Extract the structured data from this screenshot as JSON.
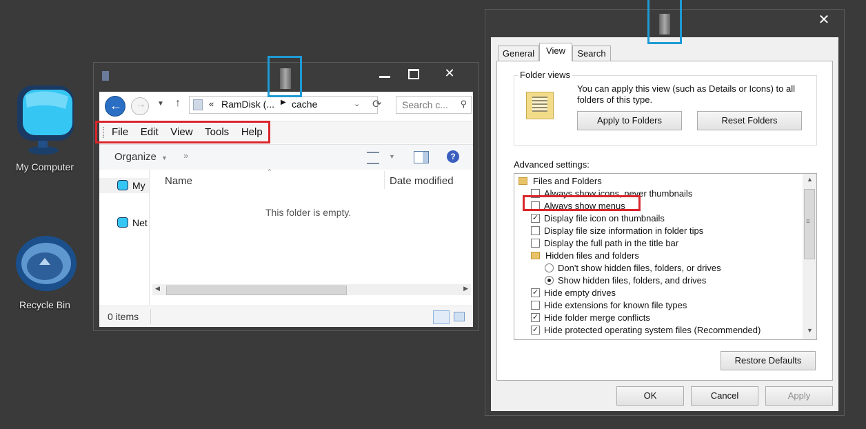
{
  "desktop": {
    "icons": [
      {
        "label": "My Computer"
      },
      {
        "label": "Recycle Bin"
      }
    ]
  },
  "explorer": {
    "address": {
      "segment1": "RamDisk (...",
      "segment2": "cache",
      "prefix": "«"
    },
    "search_placeholder": "Search c...",
    "menu": [
      "File",
      "Edit",
      "View",
      "Tools",
      "Help"
    ],
    "organize": "Organize",
    "nav_items": [
      "My",
      "Net"
    ],
    "columns": {
      "name": "Name",
      "date": "Date modified"
    },
    "empty_text": "This folder is empty.",
    "status": "0 items"
  },
  "dialog": {
    "tabs": [
      "General",
      "View",
      "Search"
    ],
    "folder_views": {
      "title": "Folder views",
      "description": "You can apply this view (such as Details or Icons) to all folders of this type.",
      "apply_button": "Apply to Folders",
      "reset_button": "Reset Folders"
    },
    "advanced_label": "Advanced settings:",
    "tree": [
      {
        "type": "folder",
        "label": "Files and Folders",
        "indent": 0
      },
      {
        "type": "checkbox",
        "label": "Always show icons, never thumbnails",
        "checked": false,
        "indent": 1
      },
      {
        "type": "checkbox",
        "label": "Always show menus",
        "checked": false,
        "indent": 1
      },
      {
        "type": "checkbox",
        "label": "Display file icon on thumbnails",
        "checked": true,
        "indent": 1
      },
      {
        "type": "checkbox",
        "label": "Display file size information in folder tips",
        "checked": false,
        "indent": 1
      },
      {
        "type": "checkbox",
        "label": "Display the full path in the title bar",
        "checked": false,
        "indent": 1
      },
      {
        "type": "folder",
        "label": "Hidden files and folders",
        "indent": 1
      },
      {
        "type": "radio",
        "label": "Don't show hidden files, folders, or drives",
        "checked": false,
        "indent": 2
      },
      {
        "type": "radio",
        "label": "Show hidden files, folders, and drives",
        "checked": true,
        "indent": 2
      },
      {
        "type": "checkbox",
        "label": "Hide empty drives",
        "checked": true,
        "indent": 1
      },
      {
        "type": "checkbox",
        "label": "Hide extensions for known file types",
        "checked": false,
        "indent": 1
      },
      {
        "type": "checkbox",
        "label": "Hide folder merge conflicts",
        "checked": true,
        "indent": 1
      },
      {
        "type": "checkbox",
        "label": "Hide protected operating system files (Recommended)",
        "checked": true,
        "indent": 1
      }
    ],
    "restore_button": "Restore Defaults",
    "ok_button": "OK",
    "cancel_button": "Cancel",
    "apply_button": "Apply"
  },
  "colors": {
    "highlight_red": "#d9262c",
    "highlight_blue": "#1e9ad6",
    "desktop": "#3a3a3a"
  }
}
